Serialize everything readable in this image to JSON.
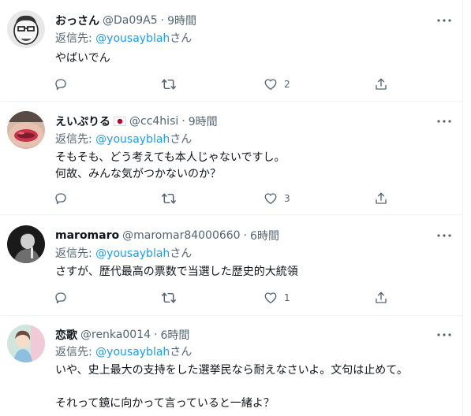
{
  "tweets": [
    {
      "name": "おっさん",
      "handle": "@Da09A5",
      "dot": "·",
      "time": "9時間",
      "reply_prefix": "返信先: ",
      "reply_mention": "@yousayblah",
      "reply_suffix": "さん",
      "lines": [
        "やばいでん"
      ],
      "likes": "2"
    },
    {
      "name": "えいぷりる",
      "flag": "japan-flag",
      "handle": "@cc4hisi",
      "dot": "·",
      "time": "9時間",
      "reply_prefix": "返信先: ",
      "reply_mention": "@yousayblah",
      "reply_suffix": "さん",
      "lines": [
        "そもそも、どう考えても本人じゃないですし。",
        "何故、みんな気がつかないのか？"
      ],
      "likes": "3"
    },
    {
      "name": "maromaro",
      "handle": "@maromar84000660",
      "dot": "·",
      "time": "6時間",
      "reply_prefix": "返信先: ",
      "reply_mention": "@yousayblah",
      "reply_suffix": "さん",
      "lines": [
        "さすが、歴代最高の票数で当選した歴史的大統領"
      ],
      "likes": "1"
    },
    {
      "name": "恋歌",
      "handle": "@renka0014",
      "dot": "·",
      "time": "6時間",
      "reply_prefix": "返信先: ",
      "reply_mention": "@yousayblah",
      "reply_suffix": "さん",
      "lines": [
        "いや、史上最大の支持をした選挙民なら耐えなさいよ。文句は止めて。",
        "",
        "それって鏡に向かって言っていると一緒よ？"
      ]
    }
  ],
  "icons": {
    "reply": "reply-icon",
    "retweet": "retweet-icon",
    "like": "like-icon",
    "share": "share-icon",
    "more": "more-icon"
  },
  "colors": {
    "text": "#0f1419",
    "secondary": "#536471",
    "link": "#1d9bf0",
    "divider": "#eff3f4"
  }
}
